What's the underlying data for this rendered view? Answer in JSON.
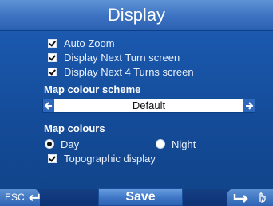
{
  "title": "Display",
  "options": [
    {
      "label": "Auto Zoom",
      "checked": true
    },
    {
      "label": "Display Next Turn screen",
      "checked": true
    },
    {
      "label": "Display Next 4 Turns screen",
      "checked": true
    }
  ],
  "map_colour_scheme": {
    "heading": "Map colour scheme",
    "value": "Default"
  },
  "map_colours": {
    "heading": "Map colours",
    "day_label": "Day",
    "night_label": "Night",
    "selected": "Day",
    "topographic_label": "Topographic display",
    "topographic_checked": true
  },
  "footer": {
    "esc_label": "ESC",
    "save_label": "Save"
  },
  "colors": {
    "background": "#1854a7",
    "title_bar": "#3e74c2"
  }
}
